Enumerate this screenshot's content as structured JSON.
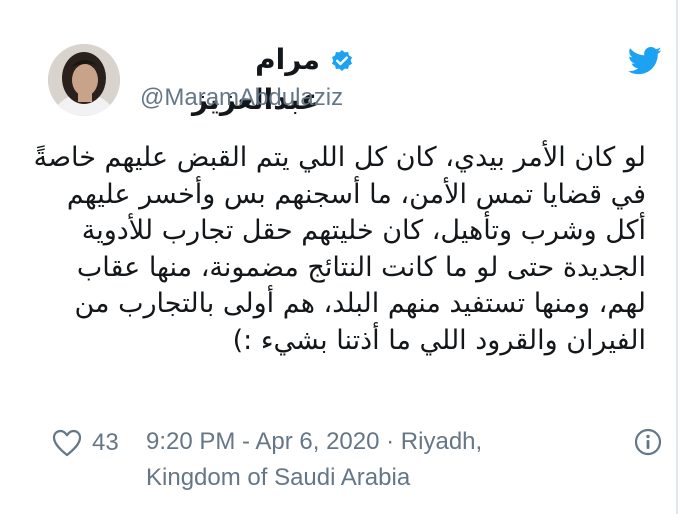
{
  "tweet": {
    "display_name": "مرام عبدالعزيز",
    "handle": "@MaramAbdulaziz",
    "text_lines": [
      "لو كان الأمر بيدي، كان كل اللي يتم القبض عليهم خاصةً",
      "في قضايا تمس الأمن، ما أسجنهم بس وأخسر عليهم",
      "أكل وشرب وتأهيل، كان خليتهم حقل تجارب للأدوية",
      "الجديدة حتى لو ما كانت النتائج مضمونة، منها عقاب",
      "لهم، ومنها تستفيد منهم البلد، هم أولى بالتجارب من",
      "الفيران والقرود اللي ما أذتنا بشيء :)"
    ],
    "like_count": "43",
    "timestamp_line1": "9:20 PM - Apr 6, 2020 · Riyadh,",
    "timestamp_line2": "Kingdom of Saudi Arabia"
  },
  "icons": {
    "brand": "twitter-bird-icon",
    "verified": "verified-badge-icon",
    "like": "heart-icon",
    "info": "info-icon"
  },
  "colors": {
    "twitter_blue": "#1da1f2",
    "secondary_text": "#657786",
    "primary_text": "#14171a"
  }
}
